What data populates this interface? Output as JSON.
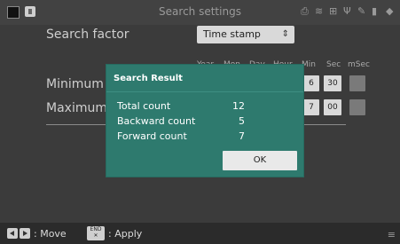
{
  "titlebar": {
    "title": "Search settings"
  },
  "main": {
    "search_factor_label": "Search factor",
    "search_factor_value": "Time stamp",
    "minimum_label": "Minimum T",
    "maximum_label": "Maximum T",
    "columns": [
      "Year",
      "Mon",
      "Day",
      "Hour",
      "Min",
      "Sec",
      "mSec"
    ],
    "min_fields": {
      "min": "6",
      "sec": "30"
    },
    "max_fields": {
      "min": "7",
      "sec": "00"
    }
  },
  "dialog": {
    "title": "Search Result",
    "rows": [
      {
        "label": "Total count",
        "value": "12"
      },
      {
        "label": "Backward count",
        "value": "5"
      },
      {
        "label": "Forward count",
        "value": "7"
      }
    ],
    "ok_label": "OK"
  },
  "bottombar": {
    "move_label": ": Move",
    "apply_label": ": Apply",
    "end_key_label": "END",
    "end_key_sub": "✕"
  },
  "icons": [
    "print-icon",
    "wifi-icon",
    "network-icon",
    "usb-icon",
    "pen-icon",
    "lock-icon",
    "card-icon"
  ],
  "colors": {
    "dialog_bg": "#2e7a6e",
    "page_bg": "#3b3b3b"
  }
}
